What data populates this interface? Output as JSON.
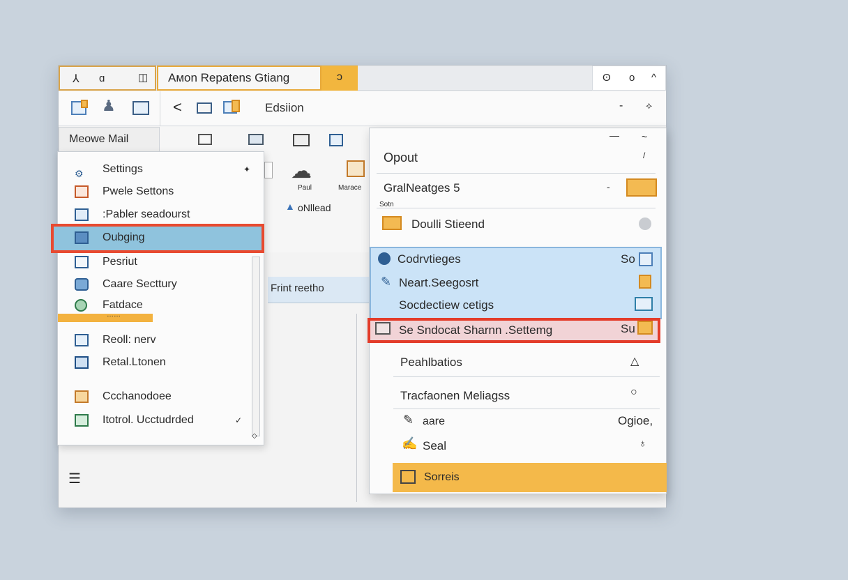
{
  "titlebar": {
    "qat_icons": [
      "pin-icon",
      "search-icon",
      "window-icon"
    ],
    "tabs_text": "Aмon   Repatens   Gtiang",
    "orange_button": "ↄ",
    "window_controls": [
      "ʘ",
      "o",
      "^"
    ]
  },
  "toolbar": {
    "back": "<",
    "section_title": "Edsiion",
    "right_controls": [
      "-",
      "⟡"
    ]
  },
  "account": {
    "label": "Meowe Mail"
  },
  "ribbon": {
    "cloud_label": "Paul",
    "mark_label": "Marace",
    "offline_label": "oNllead"
  },
  "left_menu": {
    "items": [
      {
        "label": "Settings",
        "icon": "settings-icon",
        "suffix": "✦"
      },
      {
        "label": "Pwele Settons",
        "icon": "doc-icon"
      },
      {
        "label": ":Pabler seadourst",
        "icon": "folders-icon"
      },
      {
        "label": "Oubging",
        "icon": "outbox-icon"
      },
      {
        "label": "Pesriut",
        "icon": "list-icon"
      },
      {
        "label": "Caare Secttury",
        "icon": "security-icon"
      },
      {
        "label": "Fatdace",
        "icon": "globe-icon"
      },
      {
        "label": "Reoll: nerv",
        "icon": "report-icon"
      },
      {
        "label": "Retal.Ltonen",
        "icon": "book-icon"
      },
      {
        "label": "Ccchanodoee",
        "icon": "exchange-icon"
      },
      {
        "label": "Itotrol. Ucctudrded",
        "icon": "table-icon",
        "suffix": "✓"
      }
    ],
    "orange_bar_text": "……"
  },
  "middle": {
    "bar_label": "Frint reetho"
  },
  "right_panel": {
    "title": "Opout",
    "group_label": "GralNeatges 5",
    "small_label": "Sotn",
    "default_send": "Doulli Stieend",
    "blue_items": [
      {
        "label": "Codrvtieges",
        "badge": "So"
      },
      {
        "label": "Neart.Seegosrt",
        "badge": ""
      },
      {
        "label": "Socdectiew cetigs",
        "badge": ""
      }
    ],
    "red_item": {
      "label": "Se Sndocat Sharnn .Settemg",
      "badge": "Su"
    },
    "pealth": "Peahlbatios",
    "track": "Tracfaonen Meliagss",
    "date": "aare",
    "date_right": "Ogioe,",
    "seal": "Seal",
    "sorreis": "Sorreis"
  }
}
